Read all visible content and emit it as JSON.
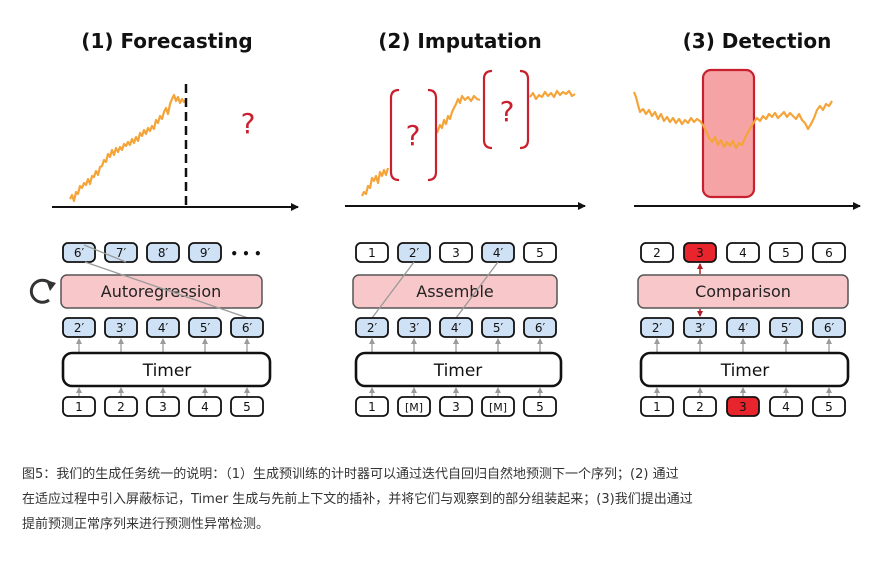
{
  "panels": [
    {
      "title": "(1) Forecasting",
      "question_marks": [
        "?"
      ],
      "top_tokens": [
        "6′",
        "7′",
        "8′",
        "9′"
      ],
      "ellipsis": "• • •",
      "middle_box": "Autoregression",
      "mid_tokens": [
        "2′",
        "3′",
        "4′",
        "5′",
        "6′"
      ],
      "model_box": "Timer",
      "input_tokens": [
        "1",
        "2",
        "3",
        "4",
        "5"
      ]
    },
    {
      "title": "(2) Imputation",
      "question_marks": [
        "?",
        "?"
      ],
      "top_tokens": [
        "1",
        "2′",
        "3",
        "4′",
        "5"
      ],
      "middle_box": "Assemble",
      "mid_tokens": [
        "2′",
        "3′",
        "4′",
        "5′",
        "6′"
      ],
      "model_box": "Timer",
      "input_tokens": [
        "1",
        "[M]",
        "3",
        "[M]",
        "5"
      ]
    },
    {
      "title": "(3) Detection",
      "top_tokens": [
        "2",
        "3",
        "4",
        "5",
        "6"
      ],
      "middle_box": "Comparison",
      "mid_tokens": [
        "2′",
        "3′",
        "4′",
        "5′",
        "6′"
      ],
      "model_box": "Timer",
      "input_tokens": [
        "1",
        "2",
        "3",
        "4",
        "5"
      ]
    }
  ],
  "colors": {
    "series": "#f5a43a",
    "accent_box": "#f8c7c9",
    "pred_token": "#cfe2f5",
    "anomaly": "#e8242c",
    "question": "#c8202e",
    "highlight_band": "#f6a3a6"
  },
  "caption_lines": [
    "图5：我们的生成任务统一的说明：（1）生成预训练的计时器可以通过迭代自回归自然地预测下一个序列；(2) 通过",
    "在适应过程中引入屏蔽标记，Timer 生成与先前上下文的插补，并将它们与观察到的部分组装起来；(3)我们提出通过",
    "提前预测正常序列来进行预测性异常检测。"
  ]
}
